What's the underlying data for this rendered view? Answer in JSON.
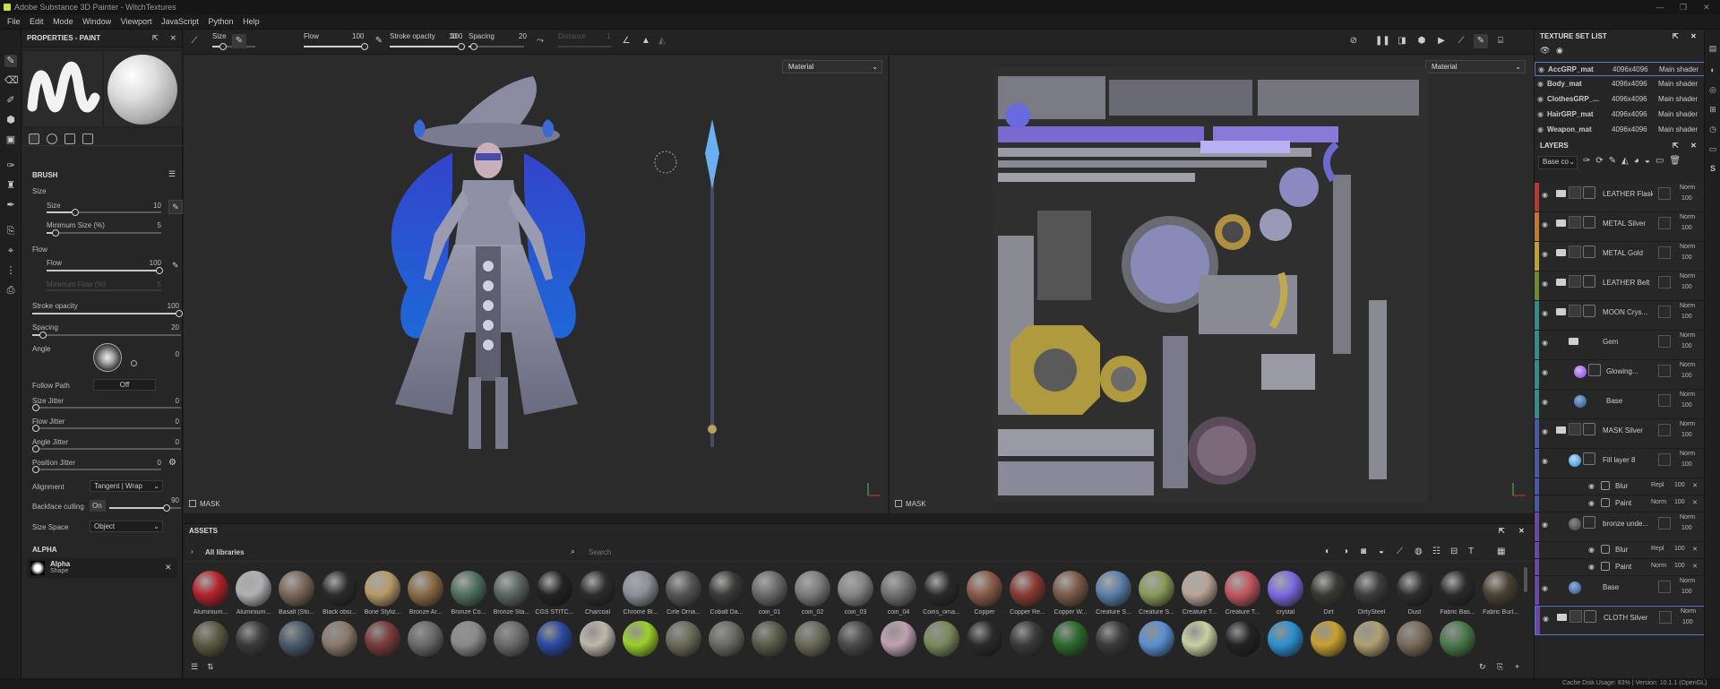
{
  "window": {
    "title": "Adobe Substance 3D Painter - WitchTextures",
    "controls": [
      "—",
      "❐",
      "✕"
    ]
  },
  "menu": [
    "File",
    "Edit",
    "Mode",
    "Window",
    "Viewport",
    "JavaScript",
    "Python",
    "Help"
  ],
  "properties": {
    "title": "PROPERTIES - PAINT",
    "brush_section": "BRUSH",
    "size_group": "Size",
    "size_label": "Size",
    "size_value": "10",
    "size_level": 0.25,
    "min_size_label": "Minimum Size (%)",
    "min_size_value": "5",
    "min_size_level": 0.05,
    "flow_group": "Flow",
    "flow_label": "Flow",
    "flow_value": "100",
    "flow_level": 1.0,
    "min_flow_label": "Minimum Flow (%)",
    "min_flow_value": "5",
    "stroke_opacity_label": "Stroke opacity",
    "stroke_opacity_value": "100",
    "stroke_opacity_level": 1.0,
    "spacing_label": "Spacing",
    "spacing_value": "20",
    "spacing_level": 0.06,
    "angle_label": "Angle",
    "angle_value": "0",
    "follow_path_label": "Follow Path",
    "follow_path_value": "Off",
    "size_jitter_label": "Size Jitter",
    "size_jitter_value": "0",
    "flow_jitter_label": "Flow Jitter",
    "flow_jitter_value": "0",
    "angle_jitter_label": "Angle Jitter",
    "angle_jitter_value": "0",
    "position_jitter_label": "Position Jitter",
    "position_jitter_value": "0",
    "alignment_label": "Alignment",
    "alignment_value": "Tangent | Wrap",
    "backface_label": "Backface culling",
    "backface_toggle": "On",
    "backface_value": "90",
    "backface_level": 0.8,
    "size_space_label": "Size Space",
    "size_space_value": "Object",
    "alpha_section": "ALPHA",
    "alpha_name": "Alpha",
    "alpha_sub": "Shape"
  },
  "toolbar": {
    "size_label": "Size",
    "size_value": "10",
    "size_level": 0.25,
    "flow_label": "Flow",
    "flow_value": "100",
    "flow_level": 1.0,
    "stroke_opacity_label": "Stroke opacity",
    "stroke_opacity_value": "100",
    "stroke_opacity_level": 1.0,
    "spacing_label": "Spacing",
    "spacing_value": "20",
    "spacing_level": 0.06,
    "distance_label": "Distance",
    "distance_value": "1"
  },
  "viewport3d": {
    "dropdown": "Material",
    "mask": "MASK"
  },
  "viewport2d": {
    "dropdown": "Material",
    "mask": "MASK"
  },
  "assets": {
    "title": "ASSETS",
    "library": "All libraries",
    "search_placeholder": "Search",
    "row1": [
      {
        "name": "Aluminium...",
        "color": "#b3232a"
      },
      {
        "name": "Aluminium...",
        "color": "#b0b0b4"
      },
      {
        "name": "Basalt (Sto...",
        "color": "#7a6656"
      },
      {
        "name": "Black obsi...",
        "color": "#2a2a2c"
      },
      {
        "name": "Bone Styliz...",
        "color": "#b79a6a"
      },
      {
        "name": "Bronze Ar...",
        "color": "#8a6a45"
      },
      {
        "name": "Bronze Co...",
        "color": "#4f6f5d"
      },
      {
        "name": "Bronze Sta...",
        "color": "#5a6562"
      },
      {
        "name": "CGS STITC...",
        "color": "#222"
      },
      {
        "name": "Charcoal",
        "color": "#2c2c2c"
      },
      {
        "name": "Chrome Bl...",
        "color": "#8a9098"
      },
      {
        "name": "Cirle Orna...",
        "color": "#555"
      },
      {
        "name": "Cobalt Da...",
        "color": "#3a3a38"
      },
      {
        "name": "coin_01",
        "color": "#6a6a6a"
      },
      {
        "name": "coin_02",
        "color": "#7a7a7a"
      },
      {
        "name": "coin_03",
        "color": "#858585"
      },
      {
        "name": "coin_04",
        "color": "#707070"
      },
      {
        "name": "Coins_orna...",
        "color": "#2a2a2a"
      },
      {
        "name": "Copper",
        "color": "#8a5a48"
      },
      {
        "name": "Copper Re...",
        "color": "#8a3a32"
      },
      {
        "name": "Copper W...",
        "color": "#7a5a48"
      },
      {
        "name": "Creature S...",
        "color": "#5a7ea8"
      },
      {
        "name": "Creature S...",
        "color": "#8a9a58"
      },
      {
        "name": "Creature T...",
        "color": "#b8a496"
      },
      {
        "name": "Creature T...",
        "color": "#c0575f"
      },
      {
        "name": "crystal",
        "color": "#7a6ae0"
      },
      {
        "name": "Dirt",
        "color": "#3a3a34"
      },
      {
        "name": "DirtySteel",
        "color": "#3c3c3c"
      },
      {
        "name": "Dust",
        "color": "#2d2d2d"
      },
      {
        "name": "Fabric Bas...",
        "color": "#2a2a2a"
      },
      {
        "name": "Fabric Burl...",
        "color": "#4a4232"
      }
    ],
    "row2": [
      {
        "color": "#5a5a42"
      },
      {
        "color": "#3a3a3a"
      },
      {
        "color": "#4a5a6a"
      },
      {
        "color": "#8a7a6a"
      },
      {
        "color": "#7a3a3a"
      },
      {
        "color": "#6a6a6a"
      },
      {
        "color": "#8a8a8a"
      },
      {
        "color": "#6a6a6a"
      },
      {
        "color": "#2a4aa0"
      },
      {
        "color": "#bdb6aa"
      },
      {
        "color": "#9ad02a"
      },
      {
        "color": "#6a6a5a"
      },
      {
        "color": "#6a6a64"
      },
      {
        "color": "#5a5a4a"
      },
      {
        "color": "#6a6a5a"
      },
      {
        "color": "#4a4a4a"
      },
      {
        "color": "#c0a0b0"
      },
      {
        "color": "#7a8a5a"
      },
      {
        "color": "#2a2a2a"
      },
      {
        "color": "#3a3a3a"
      },
      {
        "color": "#2c6a2c"
      },
      {
        "color": "#3a3a3a"
      },
      {
        "color": "#5a90d0"
      },
      {
        "color": "#c8d0a0"
      },
      {
        "color": "#222"
      },
      {
        "color": "#2a90d0"
      },
      {
        "color": "#c8a030"
      },
      {
        "color": "#b0a070"
      },
      {
        "color": "#7a6a5a"
      },
      {
        "color": "#4a7a4a"
      }
    ]
  },
  "texture_set": {
    "title": "TEXTURE SET LIST",
    "items": [
      {
        "name": "AccGRP_mat",
        "size": "4096x4096",
        "shader": "Main shader"
      },
      {
        "name": "Body_mat",
        "size": "4096x4096",
        "shader": "Main shader"
      },
      {
        "name": "ClothesGRP_...",
        "size": "4096x4096",
        "shader": "Main shader"
      },
      {
        "name": "HairGRP_mat",
        "size": "4096x4096",
        "shader": "Main shader"
      },
      {
        "name": "Weapon_mat",
        "size": "4096x4096",
        "shader": "Main shader"
      }
    ]
  },
  "layers": {
    "title": "LAYERS",
    "channel": "Base co",
    "items": [
      {
        "name": "LEATHER Flask",
        "blend": "Norm",
        "opacity": "100",
        "color": "#b43a3a",
        "type": "folder"
      },
      {
        "name": "METAL Silver",
        "blend": "Norm",
        "opacity": "100",
        "color": "#c07a30",
        "type": "folder"
      },
      {
        "name": "METAL Gold",
        "blend": "Norm",
        "opacity": "100",
        "color": "#b8a03a",
        "type": "folder"
      },
      {
        "name": "LEATHER Belt",
        "blend": "Norm",
        "opacity": "100",
        "color": "#6a8a3a",
        "type": "folder"
      },
      {
        "name": "MOON Crys...",
        "blend": "Norm",
        "opacity": "100",
        "color": "#3a8a8a",
        "type": "folder"
      },
      {
        "name": "Gem",
        "blend": "Norm",
        "opacity": "100",
        "color": "#3a8a8a",
        "type": "group"
      },
      {
        "name": "Glowing...",
        "blend": "Norm",
        "opacity": "100",
        "color": "#3a8a8a",
        "type": "fill"
      },
      {
        "name": "Base",
        "blend": "Norm",
        "opacity": "100",
        "color": "#3a8a8a",
        "type": "fill"
      },
      {
        "name": "MASK Silver",
        "blend": "Norm",
        "opacity": "100",
        "color": "#4a5aa0",
        "type": "folder"
      },
      {
        "name": "Fill layer 8",
        "blend": "Norm",
        "opacity": "100",
        "color": "#4a5aa0",
        "type": "fill"
      },
      {
        "name": "bronze unde...",
        "blend": "Norm",
        "opacity": "100",
        "color": "#6a4aa0",
        "type": "fill"
      },
      {
        "name": "Base",
        "blend": "Norm",
        "opacity": "100",
        "color": "#6a4aa0",
        "type": "fill"
      },
      {
        "name": "CLOTH Silver",
        "blend": "Norm",
        "opacity": "100",
        "color": "#6a4aa0",
        "type": "folder"
      }
    ],
    "effects": [
      {
        "name": "Blur",
        "mode": "Repl",
        "value": "100"
      },
      {
        "name": "Paint",
        "mode": "Norm",
        "value": "100"
      },
      {
        "name": "Blur",
        "mode": "Repl",
        "value": "100"
      },
      {
        "name": "Paint",
        "mode": "Norm",
        "value": "100"
      }
    ]
  },
  "status": {
    "text": "Cache Disk Usage:    83%  |  Version: 10.1.1 (OpenGL)"
  }
}
